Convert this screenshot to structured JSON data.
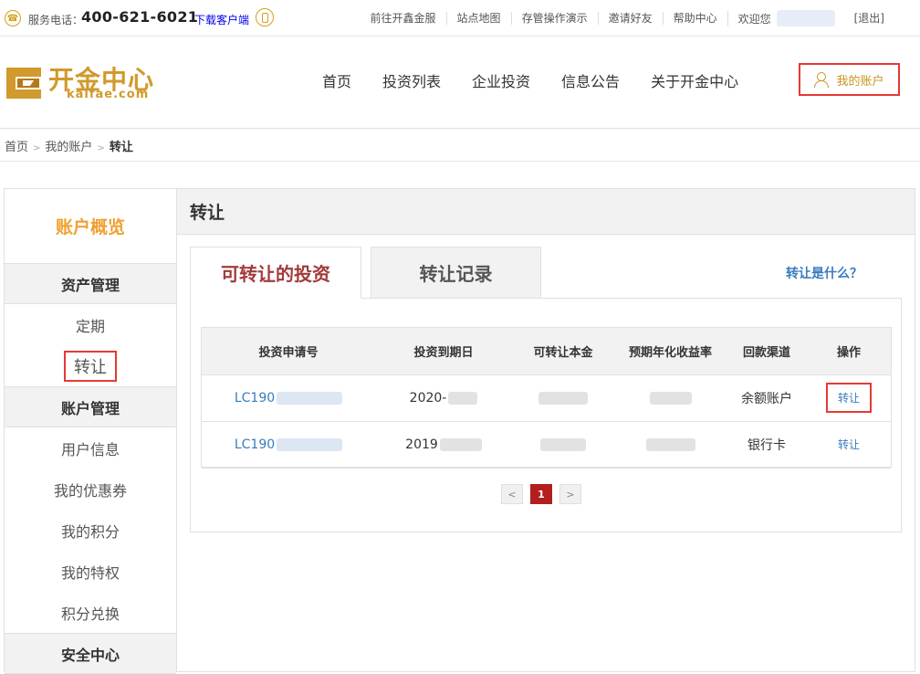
{
  "topbar": {
    "phone_label": "服务电话：",
    "phone_number": "400-621-6021",
    "download_label": "下载客户端",
    "links": [
      "前往开鑫金服",
      "站点地图",
      "存管操作演示",
      "邀请好友",
      "帮助中心"
    ],
    "welcome": "欢迎您",
    "logout": "[退出]"
  },
  "header": {
    "logo_cn": "开金中心",
    "logo_en": "kaifae.com",
    "nav": [
      "首页",
      "投资列表",
      "企业投资",
      "信息公告",
      "关于开金中心"
    ],
    "account_button": "我的账户"
  },
  "breadcrumb": {
    "items": [
      "首页",
      "我的账户"
    ],
    "current": "转让"
  },
  "sidebar": {
    "title": "账户概览",
    "sections": [
      {
        "label": "资产管理",
        "items": [
          "定期",
          "转让"
        ]
      },
      {
        "label": "账户管理",
        "items": [
          "用户信息",
          "我的优惠券",
          "我的积分",
          "我的特权",
          "积分兑换"
        ]
      },
      {
        "label": "安全中心",
        "items": []
      }
    ],
    "active_item": "转让"
  },
  "main": {
    "title": "转让",
    "tabs": [
      "可转让的投资",
      "转让记录"
    ],
    "active_tab": "可转让的投资",
    "help_link": "转让是什么？",
    "table": {
      "headers": [
        "投资申请号",
        "投资到期日",
        "可转让本金",
        "预期年化收益率",
        "回款渠道",
        "操作"
      ],
      "rows": [
        {
          "id_prefix": "LC190",
          "date_prefix": "2020-",
          "channel": "余额账户",
          "action": "转让"
        },
        {
          "id_prefix": "LC190",
          "date_prefix": "2019",
          "channel": "银行卡",
          "action": "转让"
        }
      ]
    },
    "pager": {
      "prev": "<",
      "current": "1",
      "next": ">"
    }
  },
  "colors": {
    "brand_gold": "#d09a2c",
    "highlight_red": "#e53935",
    "link_blue": "#3a7bbf",
    "tab_active": "#a33a3a",
    "pager_active": "#b31e1e"
  }
}
